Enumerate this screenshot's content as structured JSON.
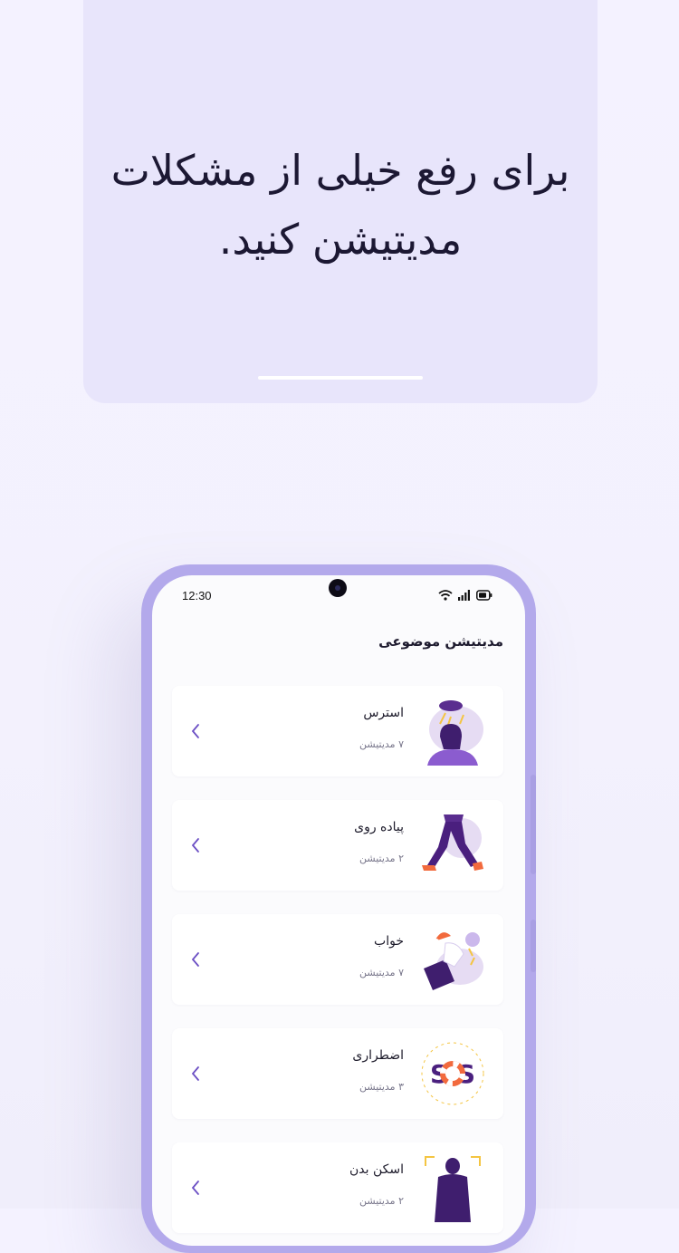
{
  "promo": {
    "line1": "برای رفع خیلی از مشکلات",
    "line2": "مدیتیشن کنید."
  },
  "status_bar": {
    "time": "12:30"
  },
  "screen": {
    "title": "مدیتیشن موضوعی",
    "items": [
      {
        "title": "استرس",
        "subtitle": "۷ مدیتیشن",
        "icon": "stress-illustration-icon"
      },
      {
        "title": "پیاده روی",
        "subtitle": "۲ مدیتیشن",
        "icon": "walking-illustration-icon"
      },
      {
        "title": "خواب",
        "subtitle": "۷ مدیتیشن",
        "icon": "sleep-illustration-icon"
      },
      {
        "title": "اضطراری",
        "subtitle": "۳ مدیتیشن",
        "icon": "sos-illustration-icon"
      },
      {
        "title": "اسکن بدن",
        "subtitle": "۲ مدیتیشن",
        "icon": "body-scan-illustration-icon"
      }
    ]
  },
  "colors": {
    "accent": "#6b4fc4",
    "illustration_dark": "#3f1e6e",
    "illustration_light": "#e6dcf3",
    "phone_frame": "#b3a9eb",
    "orange": "#f26a3d"
  }
}
